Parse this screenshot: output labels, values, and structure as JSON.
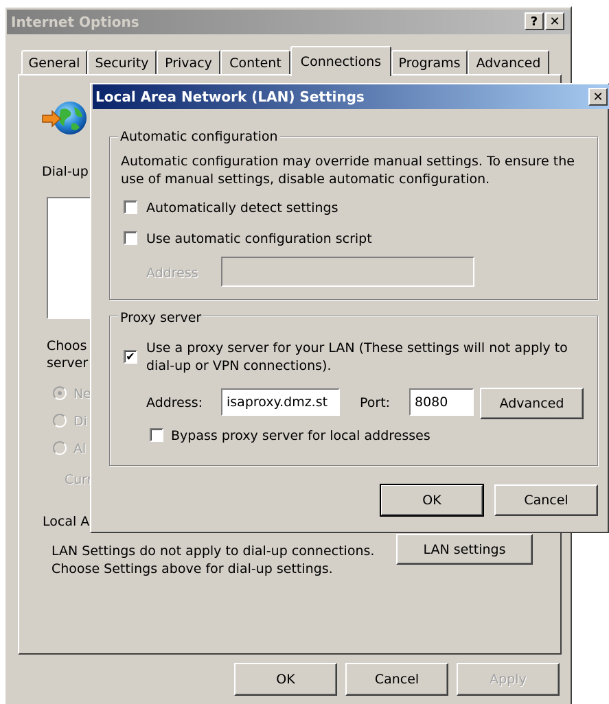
{
  "outer": {
    "title": "Internet Options",
    "help_button": "?",
    "close_button": "✕",
    "tabs": [
      {
        "label": "General"
      },
      {
        "label": "Security"
      },
      {
        "label": "Privacy"
      },
      {
        "label": "Content"
      },
      {
        "label": "Connections"
      },
      {
        "label": "Programs"
      },
      {
        "label": "Advanced"
      }
    ],
    "active_tab": "Connections",
    "dialup_label": "Dial-up",
    "choose_text_1": "Choos",
    "choose_text_2": "server",
    "radio_never": "Ne",
    "radio_dial": "Di",
    "radio_always": "Al",
    "current_label": "Curr",
    "local_area_label": "Local A",
    "lan_note_1": "LAN Settings do not apply to dial-up connections.",
    "lan_note_2": "Choose Settings above for dial-up settings.",
    "lan_settings_button": "LAN settings",
    "ok": "OK",
    "cancel": "Cancel",
    "apply": "Apply"
  },
  "lan": {
    "title": "Local Area Network (LAN) Settings",
    "close_button": "✕",
    "auto_config": {
      "legend": "Automatic configuration",
      "description_1": "Automatic configuration may override manual settings.  To ensure the",
      "description_2": "use of manual settings, disable automatic configuration.",
      "auto_detect_label": "Automatically detect settings",
      "auto_detect_checked": false,
      "script_label": "Use automatic configuration script",
      "script_checked": false,
      "address_label": "Address",
      "address_value": ""
    },
    "proxy": {
      "legend": "Proxy server",
      "use_proxy_label_1": "Use a proxy server for your LAN (These settings will not apply to",
      "use_proxy_label_2": "dial-up or VPN connections).",
      "use_proxy_checked": true,
      "address_label": "Address:",
      "address_value": "isaproxy.dmz.st",
      "port_label": "Port:",
      "port_value": "8080",
      "advanced_button": "Advanced",
      "bypass_label": "Bypass proxy server for local addresses",
      "bypass_checked": false
    },
    "ok": "OK",
    "cancel": "Cancel"
  },
  "colors": {
    "face": "#d4d0c8",
    "active_title": "#0a246a",
    "inactive_title": "#808080"
  },
  "icons": [
    "globe-connection-icon",
    "help-icon",
    "close-icon",
    "check-icon"
  ]
}
